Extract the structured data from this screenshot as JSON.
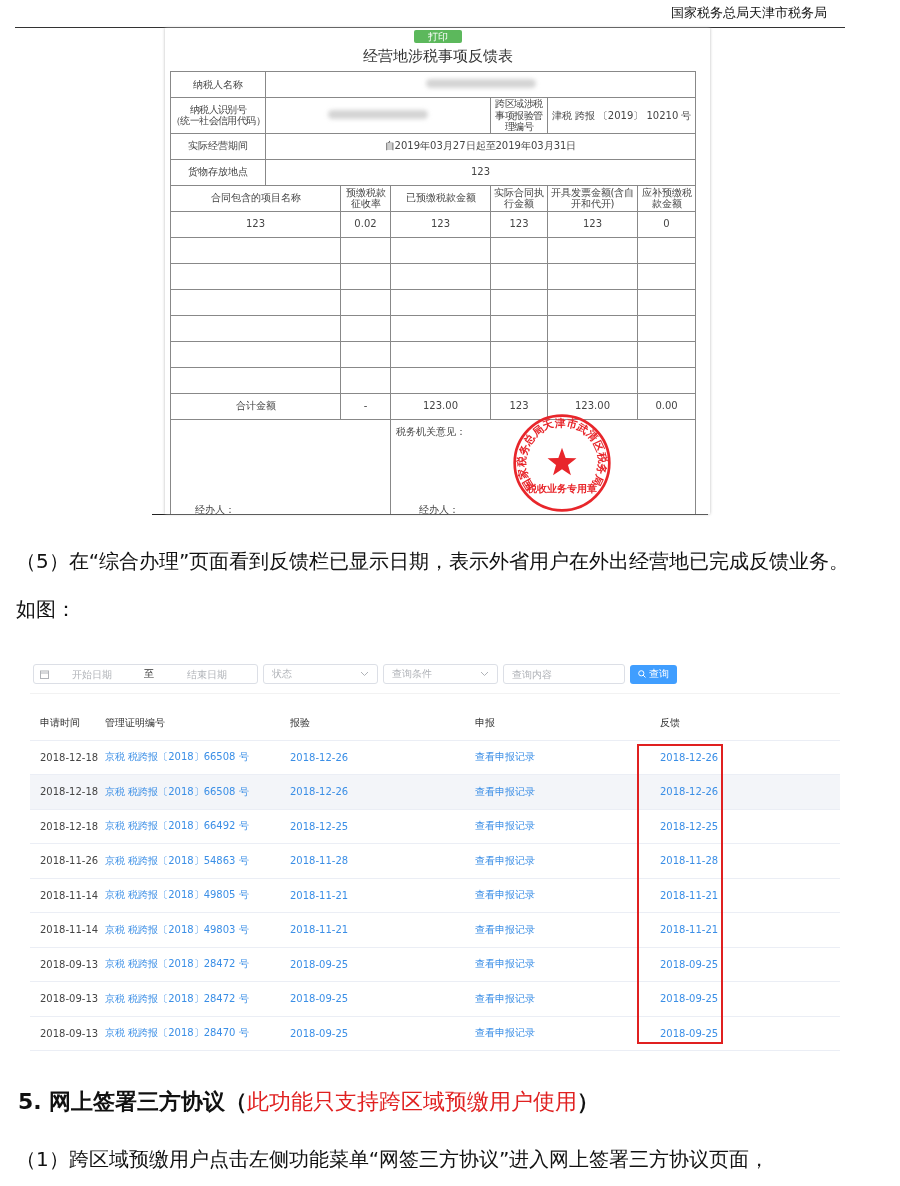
{
  "header": {
    "title": "国家税务总局天津市税务局"
  },
  "form": {
    "print_button": "打印",
    "title": "经营地涉税事项反馈表",
    "taxpayer_name_label": "纳税人名称",
    "taxpayer_id_label": [
      "纳税人识别号",
      "（统一社会信用代码）"
    ],
    "management_no_label": "跨区域涉税事项报验管理编号",
    "management_no": "津税 跨报 〔2019〕 10210 号",
    "period_label": "实际经营期间",
    "period": "自2019年03月27日起至2019年03月31日",
    "storage_label": "货物存放地点",
    "storage": "123",
    "columns": [
      "合同包含的项目名称",
      "预缴税款征收率",
      "已预缴税款金额",
      "实际合同执行金额",
      "开具发票金额(含自开和代开)",
      "应补预缴税款金额"
    ],
    "rows": [
      [
        "123",
        "0.02",
        "123",
        "123",
        "123",
        "0"
      ]
    ],
    "total": [
      "合计金额",
      "-",
      "123.00",
      "123",
      "123.00",
      "0.00"
    ],
    "left_signer_label": "经办人：",
    "opinion_label": "税务机关意见：",
    "right_signer_label": "经办人：",
    "stamp": {
      "ring_text": "国家税务总局天津市武清区税务局",
      "bottom_text": "税收业务专用章"
    }
  },
  "paragraph_1": "（5）在“综合办理”页面看到反馈栏已显示日期，表示外省用户在外出经营地已完成反馈业务。如图：",
  "query": {
    "filters": {
      "start_placeholder": "开始日期",
      "separator": "至",
      "end_placeholder": "结束日期",
      "status_placeholder": "状态",
      "condition_placeholder": "查询条件",
      "content_placeholder": "查询内容",
      "button": "查询"
    },
    "columns": [
      "申请时间",
      "管理证明编号",
      "报验",
      "申报",
      "反馈"
    ],
    "rows": [
      {
        "date": "2018-12-18",
        "cert": "京税 税跨报〔2018〕66508 号",
        "inspection": "2018-12-26",
        "declaration": "查看申报记录",
        "feedback": "2018-12-26",
        "selected": false
      },
      {
        "date": "2018-12-18",
        "cert": "京税 税跨报〔2018〕66508 号",
        "inspection": "2018-12-26",
        "declaration": "查看申报记录",
        "feedback": "2018-12-26",
        "selected": true
      },
      {
        "date": "2018-12-18",
        "cert": "京税 税跨报〔2018〕66492 号",
        "inspection": "2018-12-25",
        "declaration": "查看申报记录",
        "feedback": "2018-12-25",
        "selected": false
      },
      {
        "date": "2018-11-26",
        "cert": "京税 税跨报〔2018〕54863 号",
        "inspection": "2018-11-28",
        "declaration": "查看申报记录",
        "feedback": "2018-11-28",
        "selected": false
      },
      {
        "date": "2018-11-14",
        "cert": "京税 税跨报〔2018〕49805 号",
        "inspection": "2018-11-21",
        "declaration": "查看申报记录",
        "feedback": "2018-11-21",
        "selected": false
      },
      {
        "date": "2018-11-14",
        "cert": "京税 税跨报〔2018〕49803 号",
        "inspection": "2018-11-21",
        "declaration": "查看申报记录",
        "feedback": "2018-11-21",
        "selected": false
      },
      {
        "date": "2018-09-13",
        "cert": "京税 税跨报〔2018〕28472 号",
        "inspection": "2018-09-25",
        "declaration": "查看申报记录",
        "feedback": "2018-09-25",
        "selected": false
      },
      {
        "date": "2018-09-13",
        "cert": "京税 税跨报〔2018〕28472 号",
        "inspection": "2018-09-25",
        "declaration": "查看申报记录",
        "feedback": "2018-09-25",
        "selected": false
      },
      {
        "date": "2018-09-13",
        "cert": "京税 税跨报〔2018〕28470 号",
        "inspection": "2018-09-25",
        "declaration": "查看申报记录",
        "feedback": "2018-09-25",
        "selected": false
      }
    ]
  },
  "section_heading": [
    {
      "text": "5. 网上签署三方协议（",
      "kind": "normal"
    },
    {
      "text": "此功能只支持跨区域预缴用户使用",
      "kind": "note"
    },
    {
      "text": "）",
      "kind": "normal"
    }
  ],
  "paragraph_2": "（1）跨区域预缴用户点击左侧功能菜单“网签三方协议”进入网上签署三方协议页面，"
}
